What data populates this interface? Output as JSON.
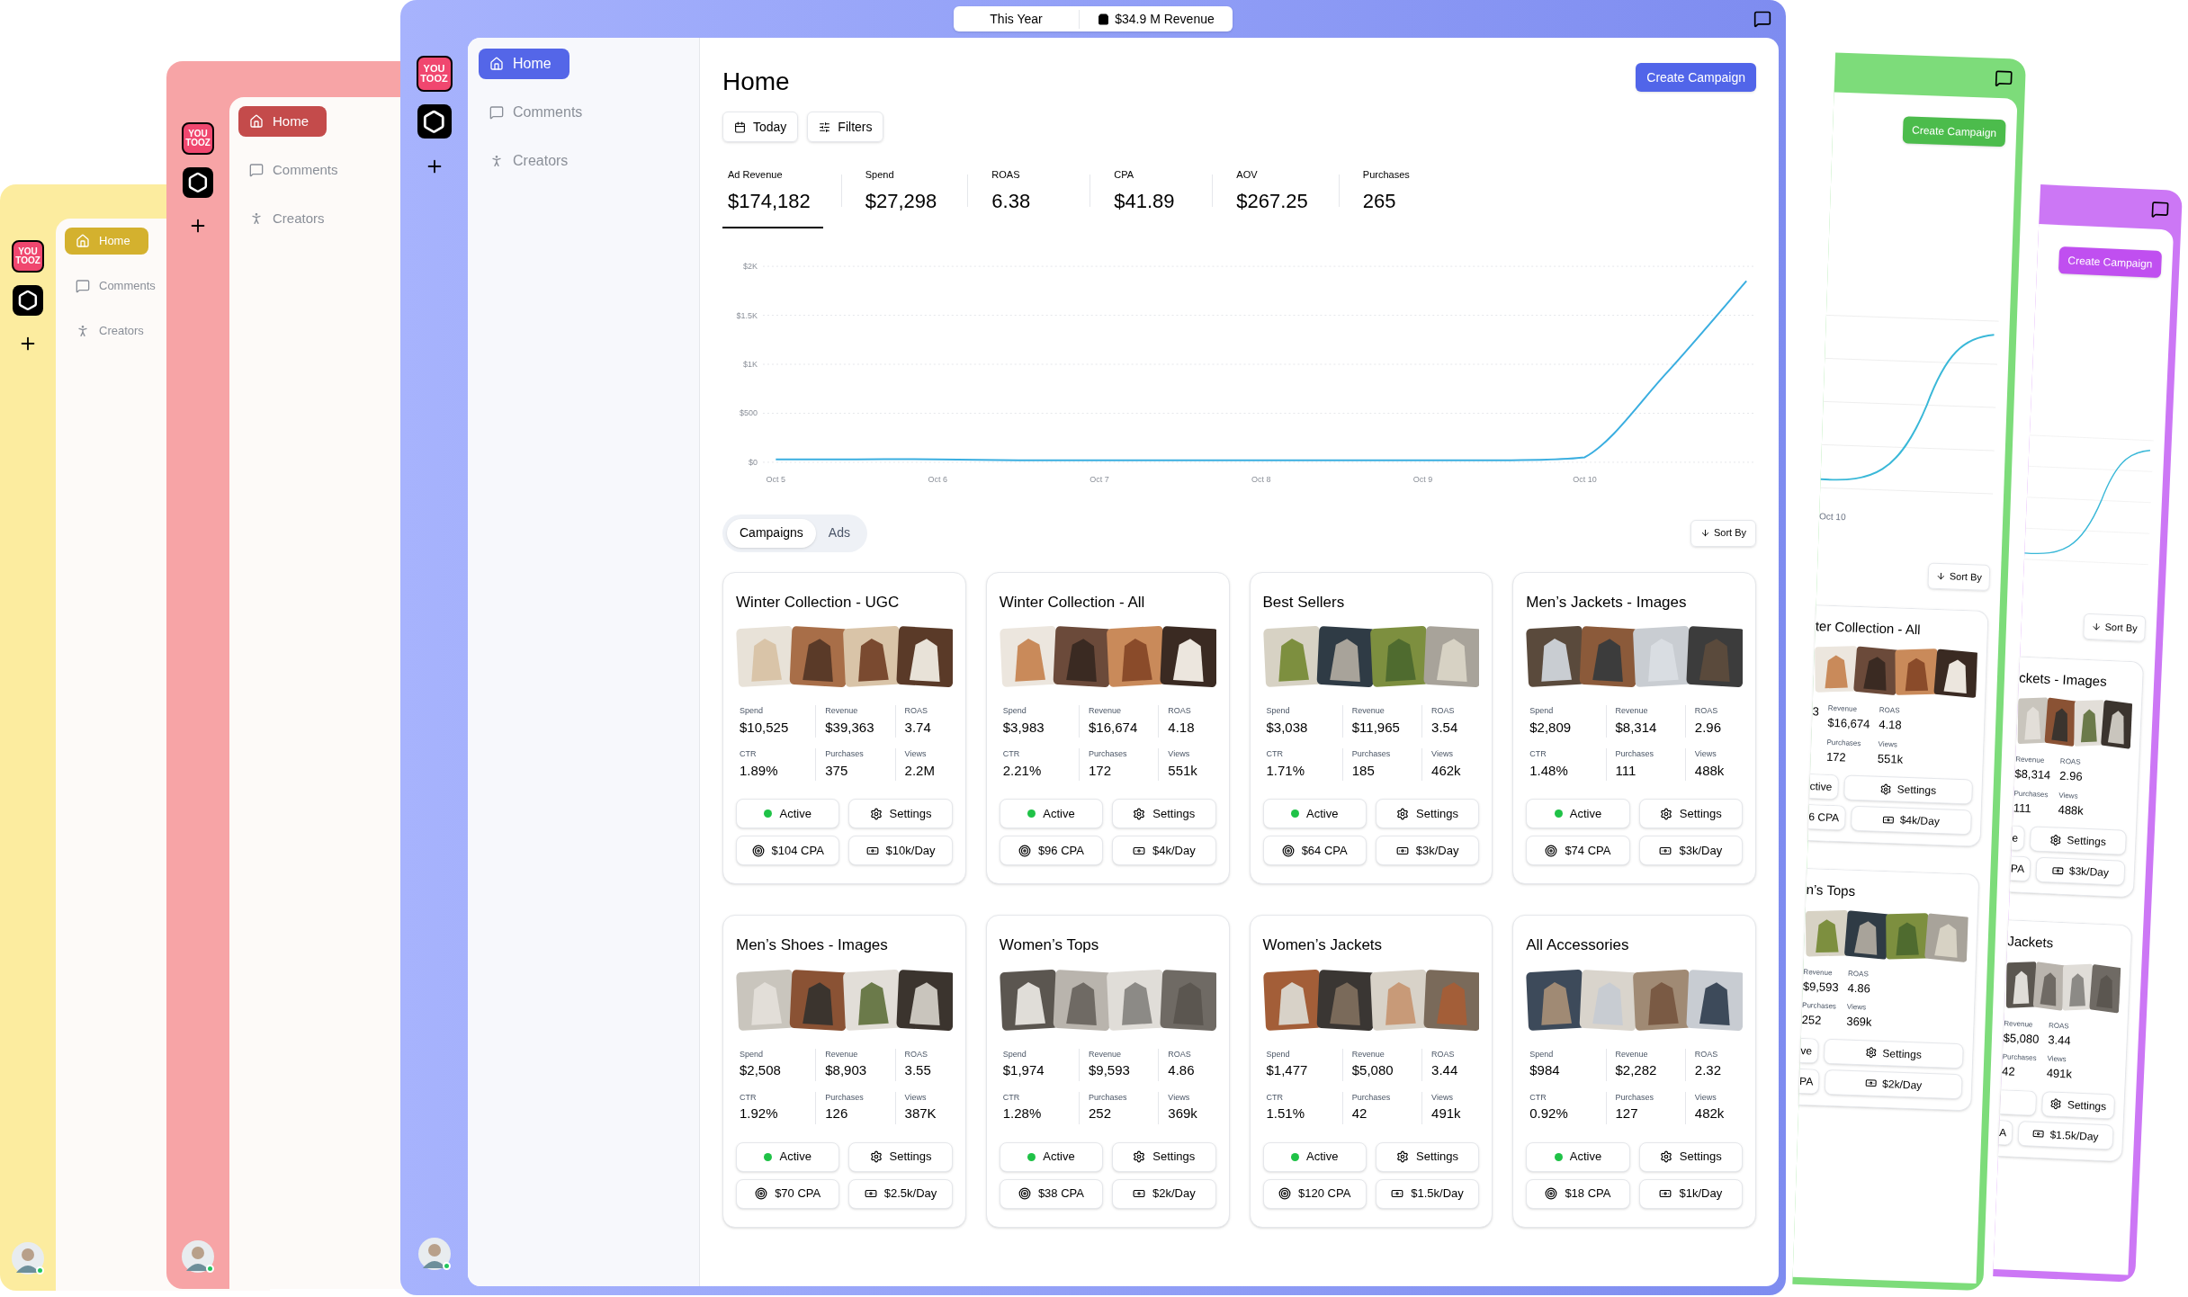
{
  "background_windows_left": [
    {
      "color": "#fcec9f",
      "rail": {
        "apps": [
          {
            "kind": "youtooz",
            "label": "YOU TOOZ"
          },
          {
            "kind": "hexagon"
          }
        ],
        "avatar": {
          "online": true
        }
      },
      "nav": [
        {
          "kind": "home",
          "label": "Home",
          "selected": true
        },
        {
          "kind": "comments",
          "label": "Comments",
          "selected": false
        },
        {
          "kind": "creators",
          "label": "Creators",
          "selected": false
        }
      ]
    },
    {
      "color": "#f7a4a6",
      "rail": {
        "apps": [
          {
            "kind": "youtooz",
            "label": "YOU TOOZ"
          },
          {
            "kind": "hexagon"
          }
        ],
        "avatar": {
          "online": true
        }
      },
      "nav": [
        {
          "kind": "home",
          "label": "Home",
          "selected": true
        },
        {
          "kind": "comments",
          "label": "Comments",
          "selected": false
        },
        {
          "kind": "creators",
          "label": "Creators",
          "selected": false
        }
      ]
    }
  ],
  "background_windows_right": [
    {
      "color": "#7ddc7a",
      "create_button": "Create Campaign",
      "chart_label": "Oct 10",
      "sort_button": "Sort By",
      "cards": [
        {
          "title": "ter Collection - All",
          "columns": [
            [
              {
                "value": "3"
              }
            ],
            [
              {
                "label": "Revenue",
                "value": "$16,674"
              },
              {
                "label": "Purchases",
                "value": "172"
              }
            ],
            [
              {
                "label": "ROAS",
                "value": "4.18"
              },
              {
                "label": "Views",
                "value": "551k"
              }
            ]
          ],
          "buttons": [
            [
              {
                "kind": "fragment",
                "label": "ctive"
              },
              {
                "kind": "settings",
                "label": "Settings"
              }
            ],
            [
              {
                "kind": "fragment",
                "label": "6 CPA"
              },
              {
                "kind": "budget",
                "label": "$4k/Day"
              }
            ]
          ]
        },
        {
          "title": "n’s Tops",
          "columns": [
            [
              {
                "label": "Revenue",
                "value": "$9,593"
              },
              {
                "label": "Purchases",
                "value": "252"
              }
            ],
            [
              {
                "label": "ROAS",
                "value": "4.86"
              },
              {
                "label": "Views",
                "value": "369k"
              }
            ]
          ],
          "buttons": [
            [
              {
                "kind": "fragment",
                "label": "ve"
              },
              {
                "kind": "settings",
                "label": "Settings"
              }
            ],
            [
              {
                "kind": "fragment",
                "label": "PA"
              },
              {
                "kind": "budget",
                "label": "$2k/Day"
              }
            ]
          ]
        }
      ]
    },
    {
      "color": "#cc77f5",
      "create_button": "Create Campaign",
      "sort_button": "Sort By",
      "cards": [
        {
          "title": "ckets - Images",
          "columns": [
            [
              {
                "label": "Revenue",
                "value": "$8,314"
              },
              {
                "label": "Purchases",
                "value": "111"
              }
            ],
            [
              {
                "label": "ROAS",
                "value": "2.96"
              },
              {
                "label": "Views",
                "value": "488k"
              }
            ]
          ],
          "buttons": [
            [
              {
                "kind": "fragment",
                "label": "e"
              },
              {
                "kind": "settings",
                "label": "Settings"
              }
            ],
            [
              {
                "kind": "fragment",
                "label": "PA"
              },
              {
                "kind": "budget",
                "label": "$3k/Day"
              }
            ]
          ]
        },
        {
          "title": "Jackets",
          "columns": [
            [
              {
                "label": "Revenue",
                "value": "$5,080"
              },
              {
                "label": "Purchases",
                "value": "42"
              }
            ],
            [
              {
                "label": "ROAS",
                "value": "3.44"
              },
              {
                "label": "Views",
                "value": "491k"
              }
            ]
          ],
          "buttons": [
            [
              {
                "kind": "stub"
              },
              {
                "kind": "settings",
                "label": "Settings"
              }
            ],
            [
              {
                "kind": "fragment",
                "label": "A"
              },
              {
                "kind": "budget",
                "label": "$1.5k/Day"
              }
            ]
          ]
        }
      ]
    }
  ],
  "top_bar": {
    "period": "This Year",
    "revenue": "$34.9 M Revenue"
  },
  "rail": {
    "apps": [
      {
        "kind": "youtooz",
        "label": "YOU TOOZ"
      },
      {
        "kind": "hexagon"
      }
    ],
    "avatar": {
      "online": true
    }
  },
  "nav": [
    {
      "kind": "home",
      "label": "Home",
      "selected": true
    },
    {
      "kind": "comments",
      "label": "Comments",
      "selected": false
    },
    {
      "kind": "creators",
      "label": "Creators",
      "selected": false
    }
  ],
  "page": {
    "title": "Home",
    "create_button": "Create Campaign",
    "filters": [
      {
        "kind": "date",
        "label": "Today"
      },
      {
        "kind": "filters",
        "label": "Filters"
      }
    ]
  },
  "metrics": [
    {
      "label": "Ad Revenue",
      "value": "$174,182",
      "selected": true
    },
    {
      "label": "Spend",
      "value": "$27,298",
      "selected": false
    },
    {
      "label": "ROAS",
      "value": "6.38",
      "selected": false
    },
    {
      "label": "CPA",
      "value": "$41.89",
      "selected": false
    },
    {
      "label": "AOV",
      "value": "$267.25",
      "selected": false
    },
    {
      "label": "Purchases",
      "value": "265",
      "selected": false
    }
  ],
  "chart_data": {
    "type": "line",
    "grid": true,
    "categories": [
      "Oct 5",
      null,
      "Oct 6",
      null,
      "Oct 7",
      null,
      "Oct 8",
      null,
      "Oct 9",
      null,
      "Oct 10",
      null,
      null
    ],
    "ylim": [
      0,
      2000
    ],
    "yticks": [
      {
        "value": 0,
        "label": "$0"
      },
      {
        "value": 500,
        "label": "$500"
      },
      {
        "value": 1000,
        "label": "$1K"
      },
      {
        "value": 1500,
        "label": "$1.5K"
      },
      {
        "value": 2000,
        "label": "$2K"
      }
    ],
    "series": [
      {
        "color": "#3aaee0",
        "values": [
          30,
          30,
          30,
          20,
          20,
          20,
          20,
          20,
          20,
          20,
          50,
          900,
          1850
        ]
      }
    ]
  },
  "tabs": [
    {
      "label": "Campaigns",
      "selected": true
    },
    {
      "label": "Ads",
      "selected": false
    }
  ],
  "sort_button": "Sort By",
  "campaigns": [
    {
      "title": "Winter Collection - UGC",
      "stats": [
        {
          "label": "Spend",
          "value": "$10,525"
        },
        {
          "label": "Revenue",
          "value": "$39,363"
        },
        {
          "label": "ROAS",
          "value": "3.74"
        },
        {
          "label": "CTR",
          "value": "1.89%"
        },
        {
          "label": "Purchases",
          "value": "375"
        },
        {
          "label": "Views",
          "value": "2.2M"
        }
      ],
      "buttons": [
        {
          "kind": "status",
          "label": "Active",
          "active": true
        },
        {
          "kind": "settings",
          "label": "Settings"
        },
        {
          "kind": "cpa",
          "label": "$104 CPA"
        },
        {
          "kind": "budget",
          "label": "$10k/Day"
        }
      ]
    },
    {
      "title": "Winter Collection - All",
      "stats": [
        {
          "label": "Spend",
          "value": "$3,983"
        },
        {
          "label": "Revenue",
          "value": "$16,674"
        },
        {
          "label": "ROAS",
          "value": "4.18"
        },
        {
          "label": "CTR",
          "value": "2.21%"
        },
        {
          "label": "Purchases",
          "value": "172"
        },
        {
          "label": "Views",
          "value": "551k"
        }
      ],
      "buttons": [
        {
          "kind": "status",
          "label": "Active",
          "active": true
        },
        {
          "kind": "settings",
          "label": "Settings"
        },
        {
          "kind": "cpa",
          "label": "$96 CPA"
        },
        {
          "kind": "budget",
          "label": "$4k/Day"
        }
      ]
    },
    {
      "title": "Best Sellers",
      "stats": [
        {
          "label": "Spend",
          "value": "$3,038"
        },
        {
          "label": "Revenue",
          "value": "$11,965"
        },
        {
          "label": "ROAS",
          "value": "3.54"
        },
        {
          "label": "CTR",
          "value": "1.71%"
        },
        {
          "label": "Purchases",
          "value": "185"
        },
        {
          "label": "Views",
          "value": "462k"
        }
      ],
      "buttons": [
        {
          "kind": "status",
          "label": "Active",
          "active": true
        },
        {
          "kind": "settings",
          "label": "Settings"
        },
        {
          "kind": "cpa",
          "label": "$64 CPA"
        },
        {
          "kind": "budget",
          "label": "$3k/Day"
        }
      ]
    },
    {
      "title": "Men’s Jackets - Images",
      "stats": [
        {
          "label": "Spend",
          "value": "$2,809"
        },
        {
          "label": "Revenue",
          "value": "$8,314"
        },
        {
          "label": "ROAS",
          "value": "2.96"
        },
        {
          "label": "CTR",
          "value": "1.48%"
        },
        {
          "label": "Purchases",
          "value": "111"
        },
        {
          "label": "Views",
          "value": "488k"
        }
      ],
      "buttons": [
        {
          "kind": "status",
          "label": "Active",
          "active": true
        },
        {
          "kind": "settings",
          "label": "Settings"
        },
        {
          "kind": "cpa",
          "label": "$74 CPA"
        },
        {
          "kind": "budget",
          "label": "$3k/Day"
        }
      ]
    },
    {
      "title": "Men’s Shoes - Images",
      "stats": [
        {
          "label": "Spend",
          "value": "$2,508"
        },
        {
          "label": "Revenue",
          "value": "$8,903"
        },
        {
          "label": "ROAS",
          "value": "3.55"
        },
        {
          "label": "CTR",
          "value": "1.92%"
        },
        {
          "label": "Purchases",
          "value": "126"
        },
        {
          "label": "Views",
          "value": "387K"
        }
      ],
      "buttons": [
        {
          "kind": "status",
          "label": "Active",
          "active": true
        },
        {
          "kind": "settings",
          "label": "Settings"
        },
        {
          "kind": "cpa",
          "label": "$70 CPA"
        },
        {
          "kind": "budget",
          "label": "$2.5k/Day"
        }
      ]
    },
    {
      "title": "Women’s Tops",
      "stats": [
        {
          "label": "Spend",
          "value": "$1,974"
        },
        {
          "label": "Revenue",
          "value": "$9,593"
        },
        {
          "label": "ROAS",
          "value": "4.86"
        },
        {
          "label": "CTR",
          "value": "1.28%"
        },
        {
          "label": "Purchases",
          "value": "252"
        },
        {
          "label": "Views",
          "value": "369k"
        }
      ],
      "buttons": [
        {
          "kind": "status",
          "label": "Active",
          "active": true
        },
        {
          "kind": "settings",
          "label": "Settings"
        },
        {
          "kind": "cpa",
          "label": "$38 CPA"
        },
        {
          "kind": "budget",
          "label": "$2k/Day"
        }
      ]
    },
    {
      "title": "Women’s Jackets",
      "stats": [
        {
          "label": "Spend",
          "value": "$1,477"
        },
        {
          "label": "Revenue",
          "value": "$5,080"
        },
        {
          "label": "ROAS",
          "value": "3.44"
        },
        {
          "label": "CTR",
          "value": "1.51%"
        },
        {
          "label": "Purchases",
          "value": "42"
        },
        {
          "label": "Views",
          "value": "491k"
        }
      ],
      "buttons": [
        {
          "kind": "status",
          "label": "Active",
          "active": true
        },
        {
          "kind": "settings",
          "label": "Settings"
        },
        {
          "kind": "cpa",
          "label": "$120 CPA"
        },
        {
          "kind": "budget",
          "label": "$1.5k/Day"
        }
      ]
    },
    {
      "title": "All Accessories",
      "stats": [
        {
          "label": "Spend",
          "value": "$984"
        },
        {
          "label": "Revenue",
          "value": "$2,282"
        },
        {
          "label": "ROAS",
          "value": "2.32"
        },
        {
          "label": "CTR",
          "value": "0.92%"
        },
        {
          "label": "Purchases",
          "value": "127"
        },
        {
          "label": "Views",
          "value": "482k"
        }
      ],
      "buttons": [
        {
          "kind": "status",
          "label": "Active",
          "active": true
        },
        {
          "kind": "settings",
          "label": "Settings"
        },
        {
          "kind": "cpa",
          "label": "$18 CPA"
        },
        {
          "kind": "budget",
          "label": "$1k/Day"
        }
      ]
    }
  ]
}
